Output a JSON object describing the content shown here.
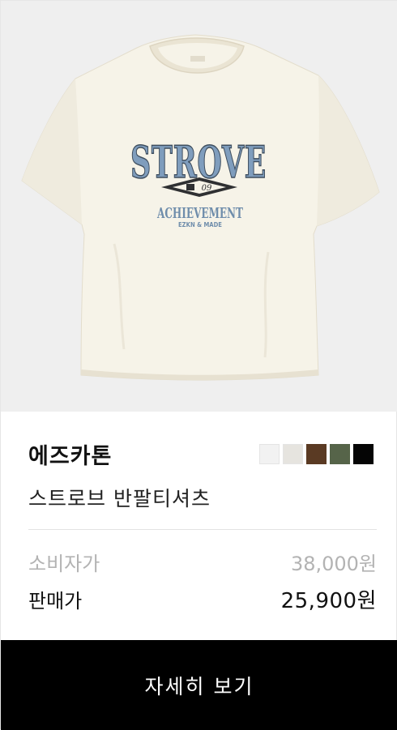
{
  "product": {
    "brand": "에즈카톤",
    "name": "스트로브 반팔티셔츠",
    "image": {
      "print_title": "STROVE",
      "badge_text": "09",
      "print_subtitle": "ACHIEVEMENT",
      "print_small": "EZKN & MADE"
    },
    "swatches": [
      {
        "name": "white",
        "color": "#f2f2f2"
      },
      {
        "name": "ivory",
        "color": "#e6e4df"
      },
      {
        "name": "brown",
        "color": "#5a3a23"
      },
      {
        "name": "khaki",
        "color": "#566449"
      },
      {
        "name": "black",
        "color": "#050505"
      }
    ]
  },
  "price": {
    "msrp_label": "소비자가",
    "msrp_value": "38,000원",
    "sale_label": "판매가",
    "sale_value": "25,900원"
  },
  "cta": {
    "detail_label": "자세히 보기"
  }
}
